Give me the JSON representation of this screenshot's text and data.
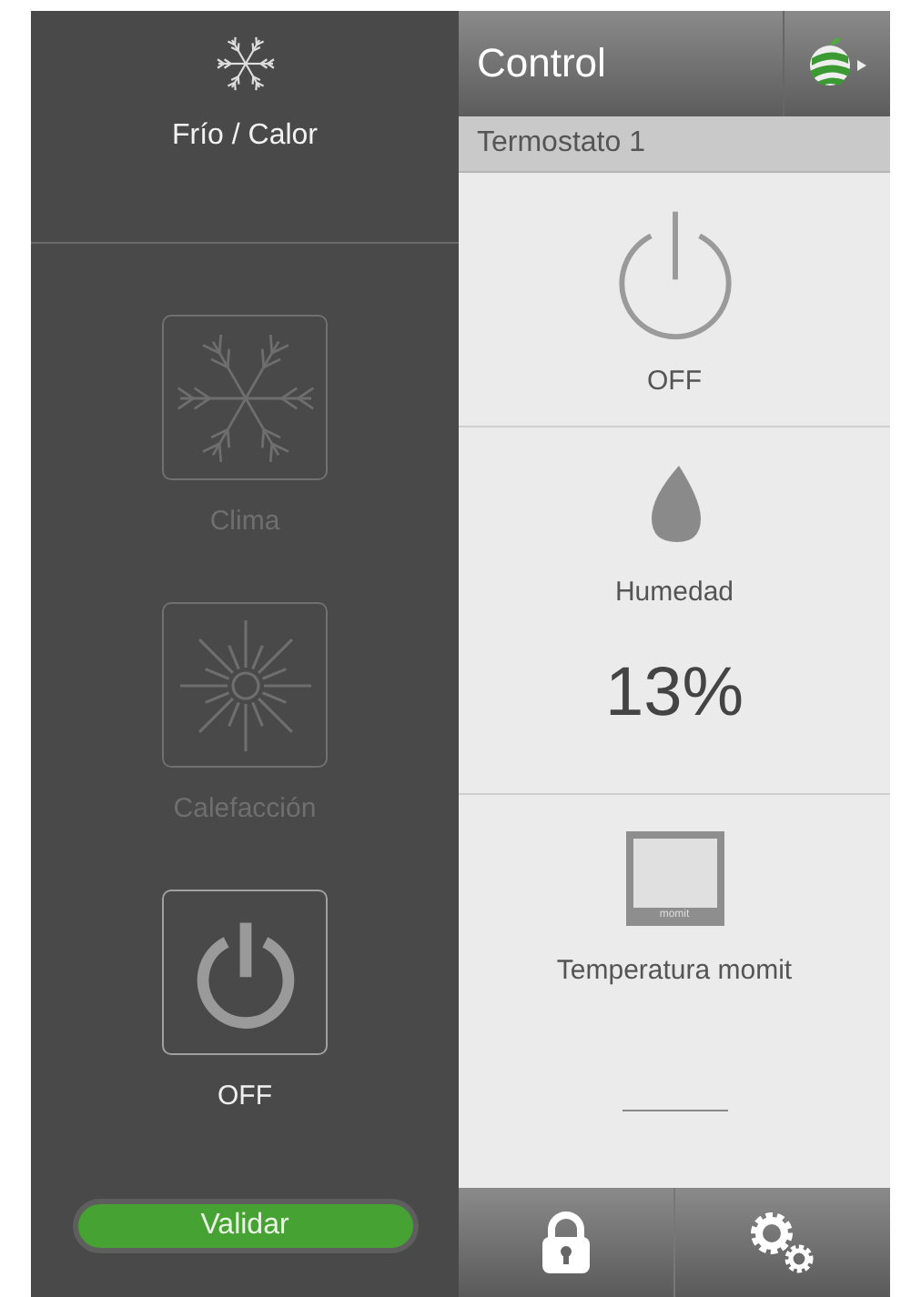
{
  "header": {
    "title": "Control"
  },
  "subheader": {
    "title": "Termostato 1"
  },
  "drawer": {
    "mode_label": "Frío / Calor",
    "options": [
      {
        "label": "Clima",
        "kind": "cool",
        "selected": false
      },
      {
        "label": "Calefacción",
        "kind": "heat",
        "selected": false
      },
      {
        "label": "OFF",
        "kind": "off",
        "selected": true
      }
    ],
    "confirm_button": "Validar"
  },
  "sections": [
    {
      "kind": "power",
      "label": "OFF"
    },
    {
      "kind": "humidity",
      "label": "Humedad",
      "value": "13%"
    },
    {
      "kind": "device",
      "device_text": "momit",
      "label": "Temperatura momit"
    }
  ]
}
